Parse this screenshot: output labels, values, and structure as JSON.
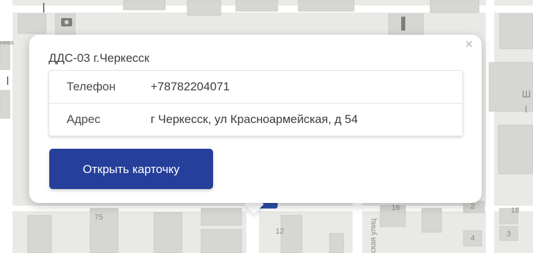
{
  "popup": {
    "title": "ДДС-03 г.Черкесск",
    "close_label": "×",
    "rows": [
      {
        "key": "Телефон",
        "value": "+78782204071"
      },
      {
        "key": "Адрес",
        "value": "г Черкесск, ул Красноармейская, д 54"
      }
    ],
    "open_card_label": "Открыть карточку"
  },
  "map": {
    "labels": {
      "house_75": "75",
      "house_12": "12",
      "house_18": "18",
      "house_16": "16",
      "house_2": "2",
      "house_4": "4",
      "house_3": "3",
      "street_fragment": "ская улиц",
      "right_fragment_1": "Ш",
      "right_fragment_2": "I",
      "left_fragment": "нева"
    }
  },
  "colors": {
    "button": "#263f9a",
    "map_background": "#e9e9e6",
    "building": "#d6d6d3",
    "marker": "#2d4fa8"
  }
}
